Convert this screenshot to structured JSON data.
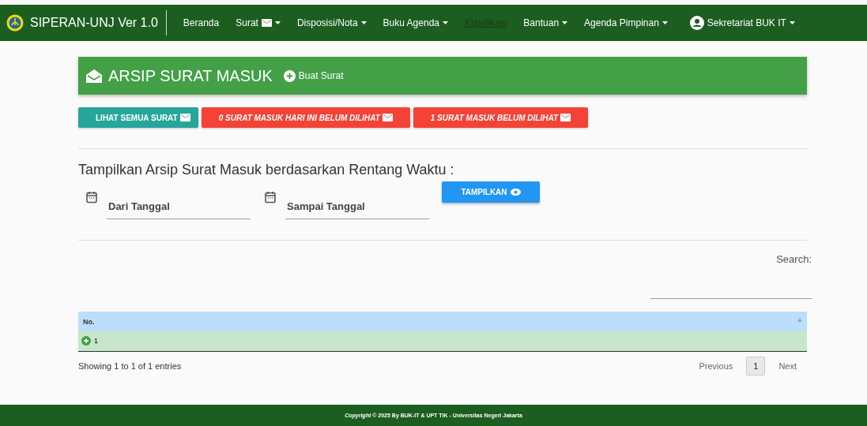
{
  "navbar": {
    "brand": "SIPERAN-UNJ Ver 1.0",
    "items": [
      {
        "label": "Beranda",
        "dropdown": false,
        "envelope": false,
        "selected": false
      },
      {
        "label": "Surat",
        "dropdown": true,
        "envelope": true,
        "selected": false
      },
      {
        "label": "Disposisi/Nota",
        "dropdown": true,
        "envelope": false,
        "selected": false
      },
      {
        "label": "Buku Agenda",
        "dropdown": true,
        "envelope": false,
        "selected": false
      },
      {
        "label": "Klasifikasi",
        "dropdown": false,
        "envelope": false,
        "selected": true
      },
      {
        "label": "Bantuan",
        "dropdown": true,
        "envelope": false,
        "selected": false
      },
      {
        "label": "Agenda Pimpinan",
        "dropdown": true,
        "envelope": false,
        "selected": false
      }
    ],
    "user": {
      "label": "Sekretariat BUK IT",
      "dropdown": true
    }
  },
  "header": {
    "title": "ARSIP SURAT MASUK",
    "action": "Buat Surat"
  },
  "filter_buttons": [
    {
      "label": "LIHAT SEMUA SURAT",
      "kind": "all"
    },
    {
      "label": "0 SURAT MASUK HARI INI BELUM DILIHAT",
      "kind": "alert"
    },
    {
      "label": "1 SURAT MASUK BELUM DILIHAT",
      "kind": "alert"
    }
  ],
  "range": {
    "heading": "Tampilkan Arsip Surat Masuk berdasarkan Rentang Waktu :",
    "fields": [
      {
        "placeholder": "Dari Tanggal"
      },
      {
        "placeholder": "Sampai Tanggal"
      }
    ],
    "button": "TAMPILKAN"
  },
  "table": {
    "search_label": "Search:",
    "columns": [
      "No."
    ],
    "rows": [
      [
        "1"
      ]
    ],
    "info": "Showing 1 to 1 of 1 entries",
    "pagination": [
      {
        "label": "Previous",
        "kind": "nav",
        "selected": false
      },
      {
        "label": "1",
        "kind": "page",
        "selected": true
      },
      {
        "label": "Next",
        "kind": "nav",
        "selected": false
      }
    ]
  },
  "footer": {
    "copyright": "Copyright",
    "text": "© 2025 By BUK-IT & UPT TIK - Universitas Negeri Jakarta"
  }
}
